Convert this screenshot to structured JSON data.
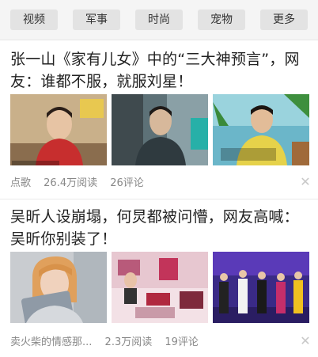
{
  "tabs": [
    "视频",
    "军事",
    "时尚",
    "宠物",
    "更多"
  ],
  "articles": [
    {
      "headline": "张一山《家有儿女》中的“三大神预言”，网友：谁都不服，就服刘星！",
      "source": "点歌",
      "reads": "26.4万阅读",
      "comments": "26评论",
      "close_icon": "close-icon"
    },
    {
      "headline": "吴昕人设崩塌，何炅都被问懵，网友高喊：吴昕你别装了！",
      "source": "卖火柴的情感那...",
      "reads": "2.3万阅读",
      "comments": "19评论",
      "close_icon": "close-icon"
    }
  ]
}
